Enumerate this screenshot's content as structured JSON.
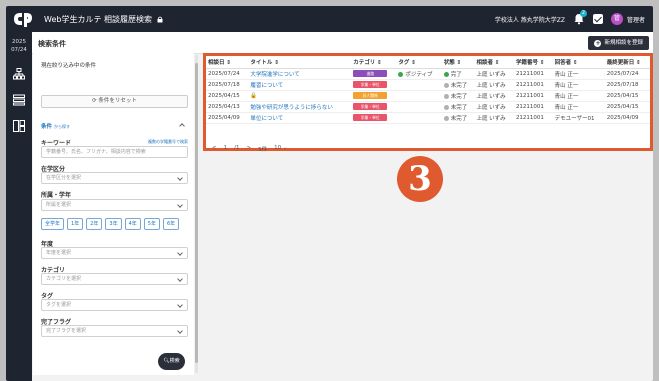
{
  "app": {
    "title": "Web学生カルテ 相談履歴検索",
    "org": "学校法人 燕丸学院大学ZZ",
    "notifications": "2",
    "user_initial": "管",
    "user_name": "管理者"
  },
  "rail": {
    "year": "2025",
    "date": "07/24"
  },
  "header": {
    "title": "検索条件",
    "new_button": "新規相談を登録"
  },
  "panel": {
    "current_conditions": "現在絞り込み中の条件",
    "reset": "条件をリセット",
    "section_title": "条件",
    "section_sub": "から探す",
    "keyword_label": "キーワード",
    "keyword_link": "複数の学籍番号で検索",
    "keyword_placeholder": "学籍番号、氏名、フリガナ、相談内容で検索",
    "enrollment_label": "在学区分",
    "enrollment_placeholder": "在学区分を選択",
    "affiliation_label": "所属・学年",
    "affiliation_placeholder": "所属を選択",
    "grades": [
      "全学年",
      "1年",
      "2年",
      "3年",
      "4年",
      "5年",
      "6年"
    ],
    "year_label": "年度",
    "year_placeholder": "年度を選択",
    "category_label": "カテゴリ",
    "category_placeholder": "カテゴリを選択",
    "tag_label": "タグ",
    "tag_placeholder": "タグを選択",
    "completion_label": "完了フラグ",
    "completion_placeholder": "完了フラグを選択",
    "search_button": "検索"
  },
  "table": {
    "columns": [
      "相談日 ⇕",
      "タイトル ⇕",
      "カテゴリ ⇕",
      "タグ ⇕",
      "状態 ⇕",
      "相談者 ⇕",
      "学籍番号 ⇕",
      "回答者 ⇕",
      "最終更新日 ⇕"
    ],
    "rows": [
      {
        "date": "2025/07/24",
        "title": "大学院進学について",
        "category": "進路",
        "cat_color": "#8a4fb8",
        "tag": "ポジティブ",
        "status": "完了",
        "status_color": "#3aa64b",
        "student": "上庭 いずみ",
        "id": "21211001",
        "responder": "青山 正一",
        "updated": "2025/07/24"
      },
      {
        "date": "2025/07/18",
        "title": "履習について",
        "category": "学業・単位",
        "cat_color": "#e8546a",
        "tag": "",
        "status": "未完了",
        "status_color": "#b0b0b0",
        "student": "上庭 いずみ",
        "id": "21211001",
        "responder": "青山 正一",
        "updated": "2025/07/18"
      },
      {
        "date": "2025/04/15",
        "title": "🔒",
        "category": "対人関係",
        "cat_color": "#f2a230",
        "tag": "",
        "status": "未完了",
        "status_color": "#b0b0b0",
        "student": "上庭 いずみ",
        "id": "21211001",
        "responder": "青山 正一",
        "updated": "2025/04/15"
      },
      {
        "date": "2025/04/13",
        "title": "勉強や研究が思うように捗らない",
        "category": "学業・単位",
        "cat_color": "#e8546a",
        "tag": "",
        "status": "未完了",
        "status_color": "#b0b0b0",
        "student": "上庭 いずみ",
        "id": "21211001",
        "responder": "青山 正一",
        "updated": "2025/04/15"
      },
      {
        "date": "2025/04/09",
        "title": "単位について",
        "category": "学業・単位",
        "cat_color": "#e8546a",
        "tag": "",
        "status": "未完了",
        "status_color": "#b0b0b0",
        "student": "上庭 いずみ",
        "id": "21211001",
        "responder": "デモユーザー01",
        "updated": "2025/04/09"
      }
    ],
    "tag_color": "#3aa64b",
    "pager": {
      "prev": "<",
      "page": "1",
      "total": "/1",
      "next": ">",
      "per_page_label": "5件",
      "per_page": "10"
    }
  },
  "marker": "3",
  "colors": {
    "accent": "#e05a2f",
    "dark": "#1f2530",
    "link": "#1e73be"
  }
}
